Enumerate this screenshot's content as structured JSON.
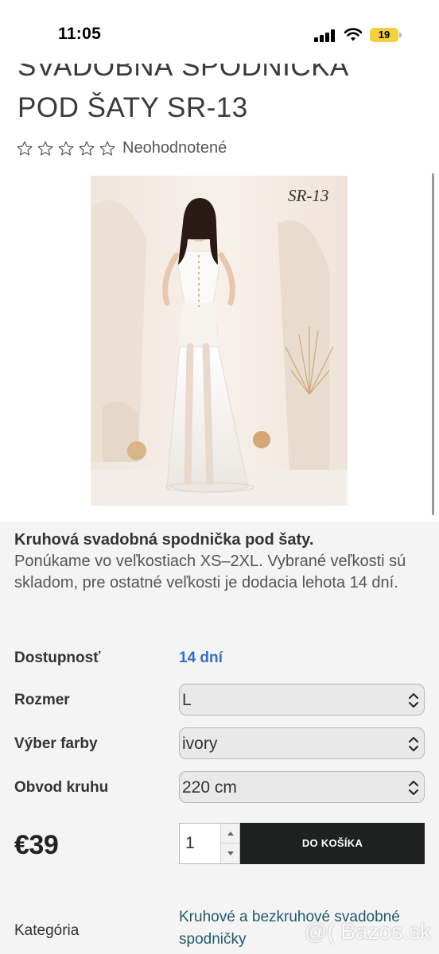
{
  "status_bar": {
    "time": "11:05",
    "battery": "19",
    "icons": [
      "signal-icon",
      "wifi-icon",
      "battery-icon"
    ]
  },
  "product": {
    "title_line1": "SVADOBNÁ SPODNIČKA",
    "title_line2": "POD ŠATY SR-13",
    "rating_stars": 0,
    "rating_max": 5,
    "rating_text": "Neohodnotené",
    "image_label": "SR-13",
    "description_strong": "Kruhová svadobná spodnička pod šaty.",
    "description": "Ponúkame vo veľkostiach XS–2XL. Vybrané veľkosti sú skladom, pre ostatné veľkosti je dodacia lehota 14 dní."
  },
  "options": {
    "availability_label": "Dostupnosť",
    "availability_value": "14 dní",
    "size_label": "Rozmer",
    "size_value": "L",
    "color_label": "Výber farby",
    "color_value": "ivory",
    "circle_label": "Obvod kruhu",
    "circle_value": "220 cm"
  },
  "purchase": {
    "price": "€39",
    "quantity": "1",
    "add_to_cart": "DO KOŠÍKA"
  },
  "category": {
    "label": "Kategória",
    "value": "Kruhové a bezkruhové svadobné spodničky"
  },
  "watermark": "@( Bazos.sk",
  "colors": {
    "availability": "#2f6fce",
    "button_bg": "#1f2121",
    "category_link": "#21596e",
    "panel_bg": "#f4f4f4"
  }
}
